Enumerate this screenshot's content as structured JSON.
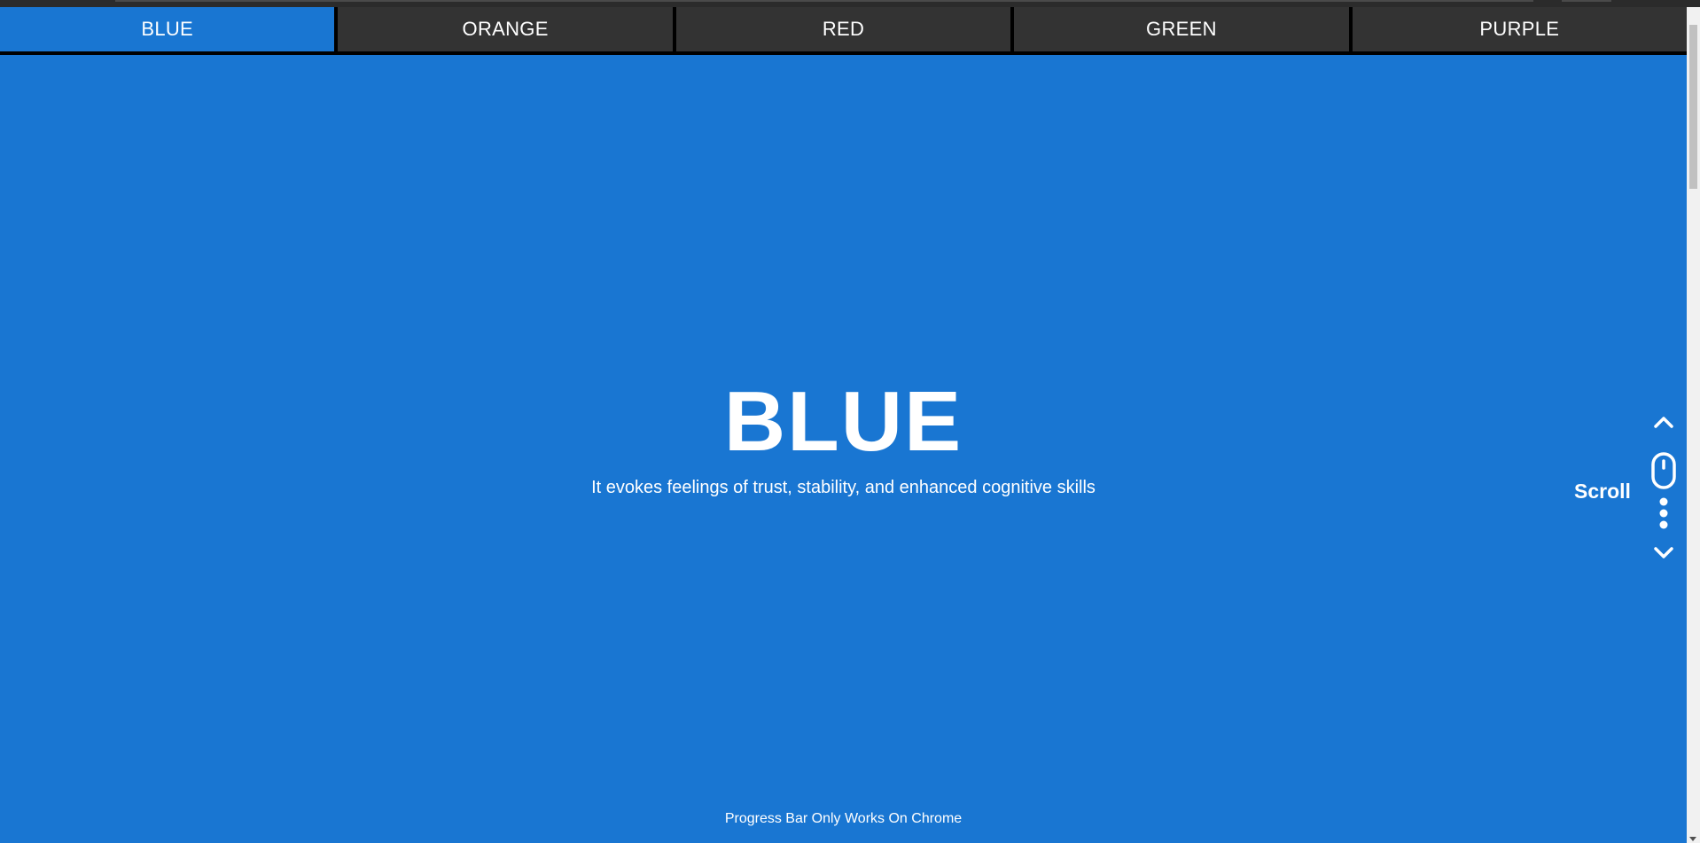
{
  "nav": {
    "tabs": [
      {
        "label": "BLUE",
        "active": true
      },
      {
        "label": "ORANGE",
        "active": false
      },
      {
        "label": "RED",
        "active": false
      },
      {
        "label": "GREEN",
        "active": false
      },
      {
        "label": "PURPLE",
        "active": false
      }
    ]
  },
  "hero": {
    "title": "BLUE",
    "subtitle": "It evokes feelings of trust, stability, and enhanced cognitive skills"
  },
  "scroll_hint": {
    "label": "Scroll",
    "icons": [
      "chevron-up-icon",
      "mouse-icon",
      "dots-icon",
      "chevron-down-icon"
    ]
  },
  "footer": {
    "note": "Progress Bar Only Works On Chrome"
  },
  "colors": {
    "accent": "#1976d2",
    "tab_bg": "#333333",
    "text": "#ffffff"
  }
}
